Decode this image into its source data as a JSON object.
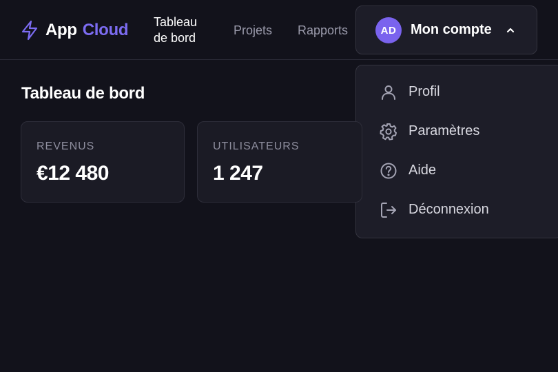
{
  "header": {
    "logo_app": "App",
    "logo_cloud": "Cloud",
    "nav": {
      "dashboard": "Tableau de bord",
      "projects": "Projets",
      "reports": "Rapports"
    },
    "account": {
      "avatar_initials": "AD",
      "label": "Mon compte"
    }
  },
  "account_menu": {
    "items": [
      {
        "label": "Profil",
        "icon": "user-icon"
      },
      {
        "label": "Paramètres",
        "icon": "gear-icon"
      },
      {
        "label": "Aide",
        "icon": "help-icon"
      },
      {
        "label": "Déconnexion",
        "icon": "logout-icon"
      }
    ]
  },
  "main": {
    "title": "Tableau de bord",
    "cards": [
      {
        "label": "REVENUS",
        "value": "€12 480"
      },
      {
        "label": "UTILISATEURS",
        "value": "1 247"
      }
    ]
  },
  "colors": {
    "background": "#12121b",
    "accent": "#7c6cf2",
    "panel": "#1d1d28"
  }
}
